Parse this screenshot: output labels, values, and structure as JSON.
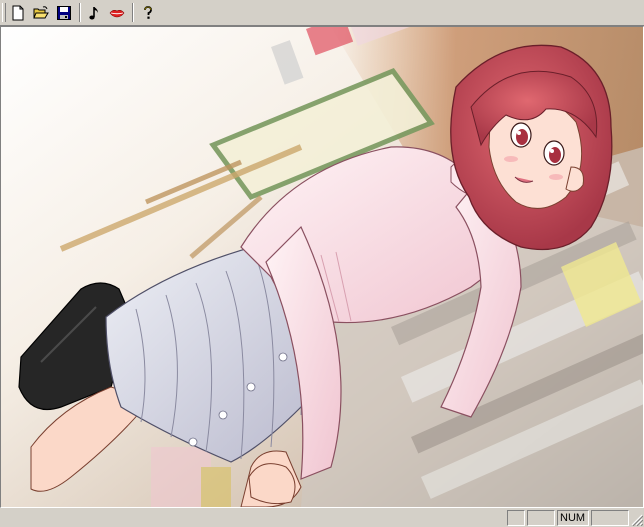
{
  "toolbar": {
    "buttons": [
      {
        "icon": "new-file-icon"
      },
      {
        "icon": "open-folder-icon"
      },
      {
        "icon": "save-icon"
      },
      {
        "icon": "music-note-icon"
      },
      {
        "icon": "lips-icon"
      },
      {
        "icon": "help-icon"
      }
    ]
  },
  "canvas": {
    "content": "illustration",
    "palette": {
      "hair": "#c8505a",
      "sweater": "#fbe4ea",
      "skirt": "#dcdce8",
      "bag": "#2a2a2a",
      "skin": "#fbd8c8",
      "background_wall": "#c89870"
    }
  },
  "statusbar": {
    "pane1": "",
    "pane2": "",
    "num": "NUM",
    "pane4": ""
  }
}
